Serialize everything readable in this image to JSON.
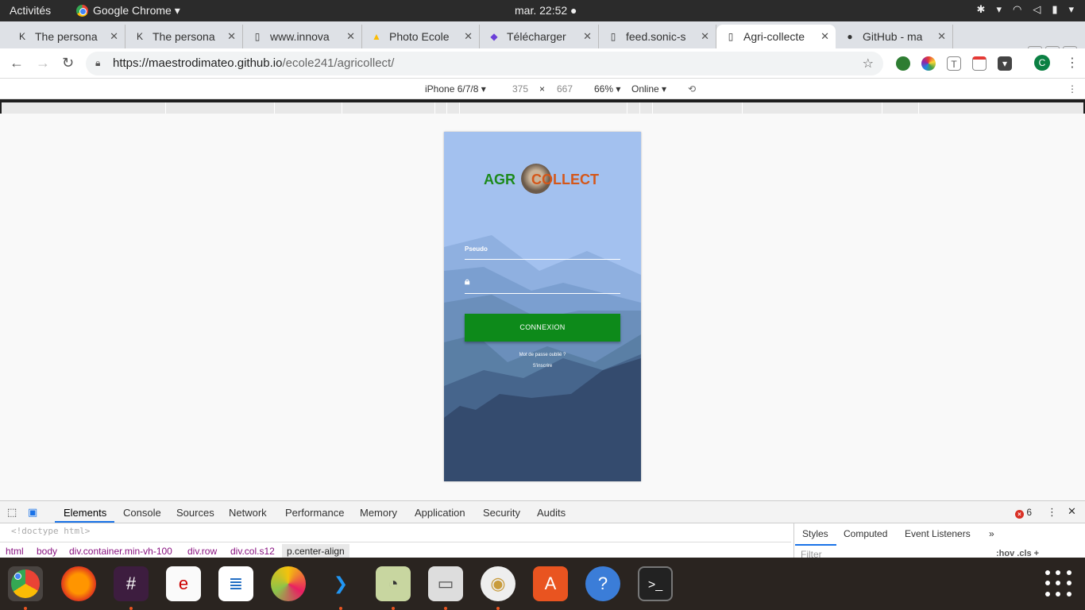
{
  "topbar": {
    "activities": "Activités",
    "app_name": "Google Chrome ▾",
    "clock": "mar. 22:52 ●",
    "sys_icons": [
      "network-icon",
      "wifi-icon",
      "volume-icon",
      "battery-icon",
      "menu-arrow-icon"
    ]
  },
  "tabs": [
    {
      "title": "The persona",
      "icon": "k-icon",
      "active": false
    },
    {
      "title": "The persona",
      "icon": "k-icon",
      "active": false
    },
    {
      "title": "www.innova",
      "icon": "page-icon",
      "active": false
    },
    {
      "title": "Photo Ecole",
      "icon": "drive-icon",
      "active": false
    },
    {
      "title": "Télécharger",
      "icon": "puzzle-icon",
      "active": false
    },
    {
      "title": "feed.sonic-s",
      "icon": "page-icon",
      "active": false
    },
    {
      "title": "Agri-collecte",
      "icon": "page-icon",
      "active": true
    },
    {
      "title": "GitHub - ma",
      "icon": "github-icon",
      "active": false
    }
  ],
  "toolbar": {
    "url_host": "https://maestrodimateo.github.io",
    "url_path": "/ecole241/agricollect/",
    "avatar_letter": "C"
  },
  "device_bar": {
    "device": "iPhone 6/7/8 ▾",
    "width": "375",
    "times": "×",
    "height": "667",
    "zoom": "66% ▾",
    "network": "Online ▾"
  },
  "app": {
    "logo_left": "AGR",
    "logo_right": "COLLECT",
    "pseudo_label": "Pseudo",
    "login_button": "CONNEXION",
    "forgot_link": "Mot de passe oublié ?",
    "register_link": "S'inscrire"
  },
  "devtools": {
    "tabs": [
      "Elements",
      "Console",
      "Sources",
      "Network",
      "Performance",
      "Memory",
      "Application",
      "Security",
      "Audits"
    ],
    "error_count": "6",
    "doctype": "<!doctype html>",
    "breadcrumbs": [
      "html",
      "body",
      "div.container.min-vh-100",
      "div.row",
      "div.col.s12",
      "p.center-align"
    ],
    "side_tabs": [
      "Styles",
      "Computed",
      "Event Listeners",
      "»"
    ],
    "filter_placeholder": "Filter",
    "hov_cls": ":hov .cls +"
  },
  "dock": [
    "chrome",
    "firefox",
    "slack",
    "document-viewer",
    "writer",
    "colors",
    "vscode",
    "image-viewer",
    "files",
    "rhythmbox",
    "software",
    "help",
    "terminal"
  ]
}
